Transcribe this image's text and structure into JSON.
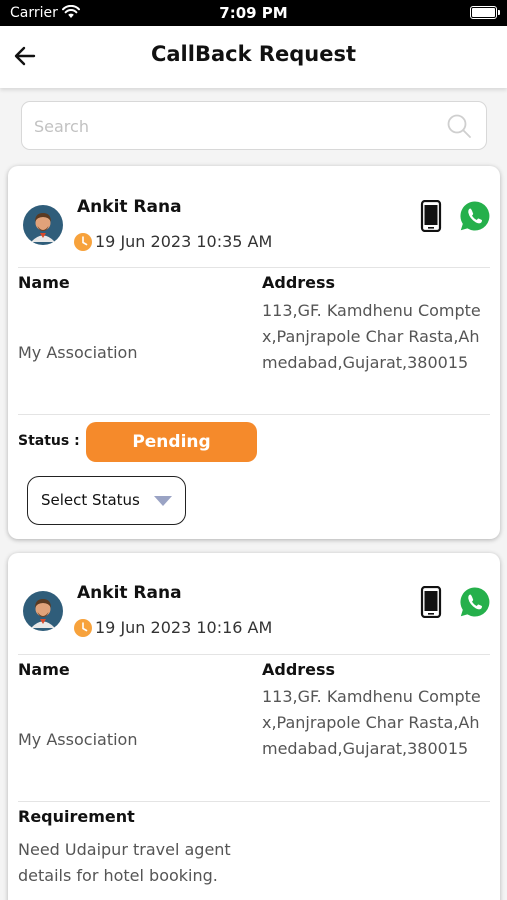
{
  "status_bar": {
    "carrier": "Carrier",
    "time": "7:09 PM"
  },
  "header": {
    "title": "CallBack Request"
  },
  "search": {
    "placeholder": "Search",
    "value": ""
  },
  "labels": {
    "name": "Name",
    "address": "Address",
    "status": "Status :",
    "requirement": "Requirement"
  },
  "requests": [
    {
      "name": "Ankit Rana",
      "datetime": "19 Jun 2023 10:35 AM",
      "association": "My Association",
      "address": "113,GF. Kamdhenu Comptex,Panjrapole Char Rasta,Ahmedabad,Gujarat,380015",
      "status": "Pending",
      "select_placeholder": "Select Status"
    },
    {
      "name": "Ankit Rana",
      "datetime": "19 Jun 2023 10:16 AM",
      "association": "My Association",
      "address": "113,GF. Kamdhenu Comptex,Panjrapole Char Rasta,Ahmedabad,Gujarat,380015",
      "requirement": "Need Udaipur travel agent details for hotel booking."
    }
  ],
  "colors": {
    "accent": "#f58a2b",
    "whatsapp": "#25b04b",
    "clock": "#f7a23c"
  },
  "icons": [
    "back-arrow-icon",
    "search-icon",
    "avatar",
    "clock-icon",
    "phone-icon",
    "whatsapp-icon",
    "chevron-down-icon",
    "wifi-icon",
    "battery-icon"
  ]
}
